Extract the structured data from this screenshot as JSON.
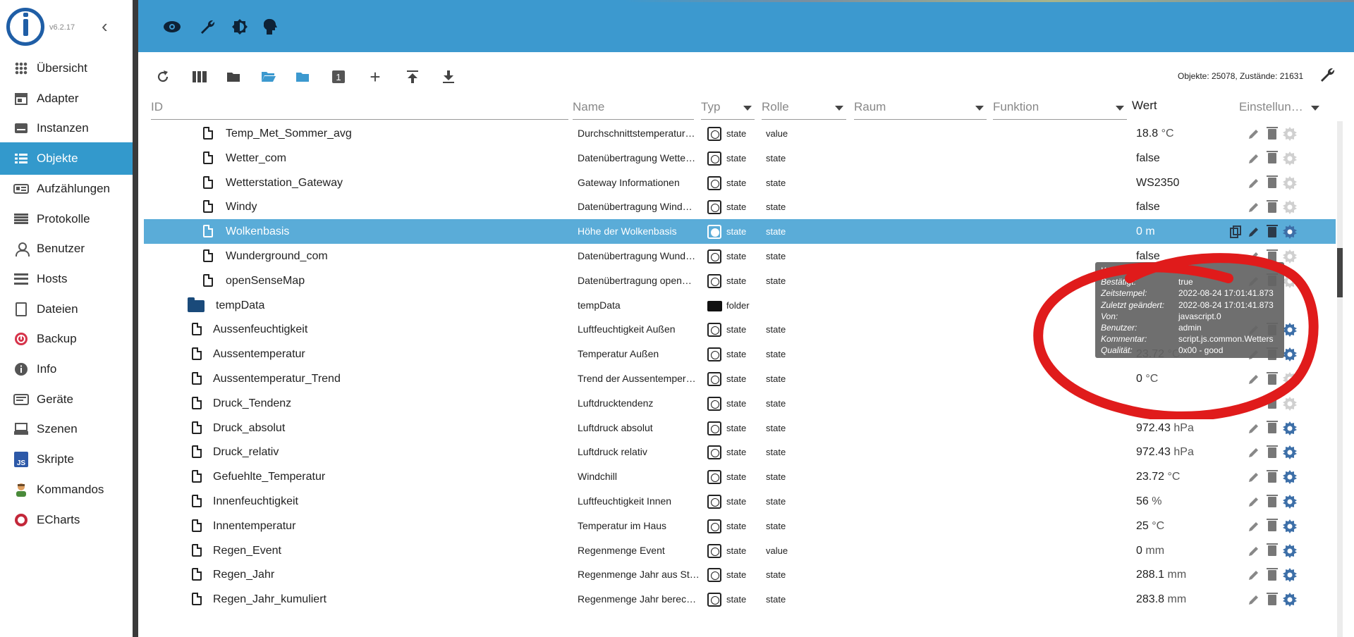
{
  "app": {
    "version": "v6.2.17"
  },
  "sidebar": {
    "items": [
      {
        "label": "Übersicht",
        "icon": "grid-icon"
      },
      {
        "label": "Adapter",
        "icon": "store-icon"
      },
      {
        "label": "Instanzen",
        "icon": "instances-icon"
      },
      {
        "label": "Objekte",
        "icon": "list-icon",
        "active": true
      },
      {
        "label": "Aufzählungen",
        "icon": "enum-icon"
      },
      {
        "label": "Protokolle",
        "icon": "log-icon"
      },
      {
        "label": "Benutzer",
        "icon": "user-icon"
      },
      {
        "label": "Hosts",
        "icon": "hosts-icon"
      },
      {
        "label": "Dateien",
        "icon": "file-icon"
      },
      {
        "label": "Backup",
        "icon": "backup-icon"
      },
      {
        "label": "Info",
        "icon": "info-icon"
      },
      {
        "label": "Geräte",
        "icon": "devices-icon"
      },
      {
        "label": "Szenen",
        "icon": "scenes-icon"
      },
      {
        "label": "Skripte",
        "icon": "js-icon"
      },
      {
        "label": "Kommandos",
        "icon": "commands-icon"
      },
      {
        "label": "ECharts",
        "icon": "echarts-icon"
      }
    ]
  },
  "toolbar": {
    "counts": "Objekte: 25078, Zustände: 21631"
  },
  "columns": {
    "id": "ID",
    "name": "Name",
    "typ": "Typ",
    "rolle": "Rolle",
    "raum": "Raum",
    "funktion": "Funktion",
    "wert": "Wert",
    "einstellungen": "Einstellun…"
  },
  "rows": [
    {
      "id": "Temp_Met_Sommer_avg",
      "name": "Durchschnittstemperatur…",
      "typ": "state",
      "rolle": "value",
      "wert": "18.8",
      "unit": "°C",
      "level": 2,
      "gear": "dim"
    },
    {
      "id": "Wetter_com",
      "name": "Datenübertragung Wette…",
      "typ": "state",
      "rolle": "state",
      "wert": "false",
      "unit": "",
      "level": 2,
      "gear": "dim"
    },
    {
      "id": "Wetterstation_Gateway",
      "name": "Gateway Informationen",
      "typ": "state",
      "rolle": "state",
      "wert": "WS2350",
      "unit": "",
      "level": 2,
      "gear": "dim"
    },
    {
      "id": "Windy",
      "name": "Datenübertragung Wind…",
      "typ": "state",
      "rolle": "state",
      "wert": "false",
      "unit": "",
      "level": 2,
      "gear": "dim"
    },
    {
      "id": "Wolkenbasis",
      "name": "Höhe der Wolkenbasis",
      "typ": "state",
      "rolle": "state",
      "wert": "0",
      "unit": "m",
      "level": 2,
      "selected": true,
      "gear": "dim"
    },
    {
      "id": "Wunderground_com",
      "name": "Datenübertragung Wund…",
      "typ": "state",
      "rolle": "state",
      "wert": "false",
      "unit": "",
      "level": 2,
      "gear": "dim"
    },
    {
      "id": "openSenseMap",
      "name": "Datenübertragung open…",
      "typ": "state",
      "rolle": "state",
      "wert": "",
      "unit": "",
      "level": 2,
      "gear": "dim"
    },
    {
      "id": "tempData",
      "name": "tempData",
      "typ": "folder",
      "rolle": "",
      "wert": "",
      "unit": "",
      "level": 1,
      "folder": true,
      "gear": "none"
    },
    {
      "id": "Aussenfeuchtigkeit",
      "name": "Luftfeuchtigkeit Außen",
      "typ": "state",
      "rolle": "state",
      "wert": "",
      "unit": "",
      "level": 1,
      "gear": "on"
    },
    {
      "id": "Aussentemperatur",
      "name": "Temperatur Außen",
      "typ": "state",
      "rolle": "state",
      "wert": "23.72",
      "unit": "°C",
      "level": 1,
      "gear": "on"
    },
    {
      "id": "Aussentemperatur_Trend",
      "name": "Trend der Aussentemper…",
      "typ": "state",
      "rolle": "state",
      "wert": "0",
      "unit": "°C",
      "level": 1,
      "gear": "dim"
    },
    {
      "id": "Druck_Tendenz",
      "name": "Luftdrucktendenz",
      "typ": "state",
      "rolle": "state",
      "wert": "",
      "unit": "",
      "level": 1,
      "gear": "dim"
    },
    {
      "id": "Druck_absolut",
      "name": "Luftdruck absolut",
      "typ": "state",
      "rolle": "state",
      "wert": "972.43",
      "unit": "hPa",
      "level": 1,
      "gear": "on"
    },
    {
      "id": "Druck_relativ",
      "name": "Luftdruck relativ",
      "typ": "state",
      "rolle": "state",
      "wert": "972.43",
      "unit": "hPa",
      "level": 1,
      "gear": "on"
    },
    {
      "id": "Gefuehlte_Temperatur",
      "name": "Windchill",
      "typ": "state",
      "rolle": "state",
      "wert": "23.72",
      "unit": "°C",
      "level": 1,
      "gear": "on"
    },
    {
      "id": "Innenfeuchtigkeit",
      "name": "Luftfeuchtigkeit Innen",
      "typ": "state",
      "rolle": "state",
      "wert": "56",
      "unit": "%",
      "level": 1,
      "gear": "on"
    },
    {
      "id": "Innentemperatur",
      "name": "Temperatur im Haus",
      "typ": "state",
      "rolle": "state",
      "wert": "25",
      "unit": "°C",
      "level": 1,
      "gear": "on"
    },
    {
      "id": "Regen_Event",
      "name": "Regenmenge Event",
      "typ": "state",
      "rolle": "value",
      "wert": "0",
      "unit": "mm",
      "level": 1,
      "gear": "on"
    },
    {
      "id": "Regen_Jahr",
      "name": "Regenmenge Jahr aus St…",
      "typ": "state",
      "rolle": "state",
      "wert": "288.1",
      "unit": "mm",
      "level": 1,
      "gear": "on"
    },
    {
      "id": "Regen_Jahr_kumuliert",
      "name": "Regenmenge Jahr berec…",
      "typ": "state",
      "rolle": "state",
      "wert": "283.8",
      "unit": "mm",
      "level": 1,
      "gear": "on"
    }
  ],
  "tooltip": [
    {
      "k": "Wert:",
      "v": "0"
    },
    {
      "k": "Bestätigt:",
      "v": "true"
    },
    {
      "k": "Zeitstempel:",
      "v": "2022-08-24 17:01:41.873"
    },
    {
      "k": "Zuletzt geändert:",
      "v": "2022-08-24 17:01:41.873"
    },
    {
      "k": "Von:",
      "v": "javascript.0"
    },
    {
      "k": "Benutzer:",
      "v": "admin"
    },
    {
      "k": "Kommentar:",
      "v": "script.js.common.Wetters"
    },
    {
      "k": "Qualität:",
      "v": "0x00 - good"
    }
  ],
  "colors": {
    "accent": "#3c99cf",
    "selected_row": "#5aacd8",
    "annotation": "#e01b1b"
  }
}
